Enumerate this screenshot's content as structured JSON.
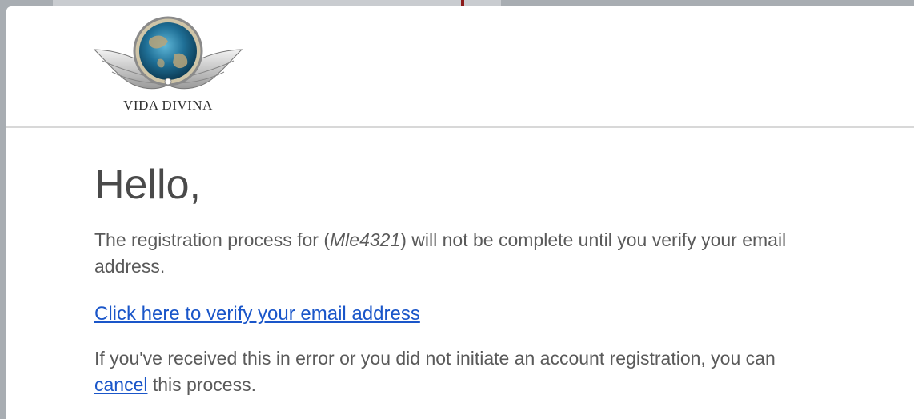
{
  "logo": {
    "brand_text": "VIDA DIVINA",
    "icon": "winged-globe-logo"
  },
  "message": {
    "greeting": "Hello,",
    "para1_before": "The registration process for (",
    "username": "Mle4321",
    "para1_after": ") will not be complete until you verify your email address.",
    "verify_link": "Click here to verify your email address",
    "para2_before": "If you've received this in error or you did not initiate an account registration, you can ",
    "cancel_link": "cancel",
    "para2_after": " this process."
  },
  "colors": {
    "link": "#1a56c9",
    "text": "#5a5a5a",
    "background": "#a8adb2"
  }
}
